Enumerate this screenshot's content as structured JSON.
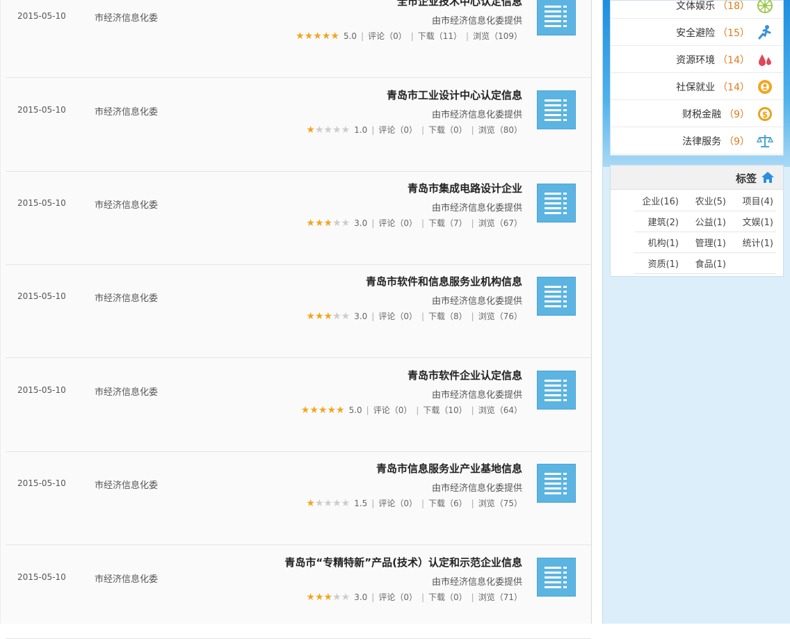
{
  "rows": [
    {
      "title": "全市企业技术中心认定信息",
      "provider": "由市经济信息化委提供",
      "rating": "5.0",
      "stars": 5,
      "comments_label": "评论（0）",
      "downloads_label": "下载（11）",
      "views_label": "浏览（109）",
      "source": "市经济信息化委",
      "date": "2015-05-10"
    },
    {
      "title": "青岛市工业设计中心认定信息",
      "provider": "由市经济信息化委提供",
      "rating": "1.0",
      "stars": 1,
      "comments_label": "评论（0）",
      "downloads_label": "下载（0）",
      "views_label": "浏览（80）",
      "source": "市经济信息化委",
      "date": "2015-05-10"
    },
    {
      "title": "青岛市集成电路设计企业",
      "provider": "由市经济信息化委提供",
      "rating": "3.0",
      "stars": 3,
      "comments_label": "评论（0）",
      "downloads_label": "下载（7）",
      "views_label": "浏览（67）",
      "source": "市经济信息化委",
      "date": "2015-05-10"
    },
    {
      "title": "青岛市软件和信息服务业机构信息",
      "provider": "由市经济信息化委提供",
      "rating": "3.0",
      "stars": 3,
      "comments_label": "评论（0）",
      "downloads_label": "下载（8）",
      "views_label": "浏览（76）",
      "source": "市经济信息化委",
      "date": "2015-05-10"
    },
    {
      "title": "青岛市软件企业认定信息",
      "provider": "由市经济信息化委提供",
      "rating": "5.0",
      "stars": 5,
      "comments_label": "评论（0）",
      "downloads_label": "下载（10）",
      "views_label": "浏览（64）",
      "source": "市经济信息化委",
      "date": "2015-05-10"
    },
    {
      "title": "青岛市信息服务业产业基地信息",
      "provider": "由市经济信息化委提供",
      "rating": "1.5",
      "stars": 1,
      "comments_label": "评论（0）",
      "downloads_label": "下载（6）",
      "views_label": "浏览（75）",
      "source": "市经济信息化委",
      "date": "2015-05-10"
    },
    {
      "title": "青岛市“专精特新”产品(技术）认定和示范企业信息",
      "provider": "由市经济信息化委提供",
      "rating": "3.0",
      "stars": 3,
      "comments_label": "评论（0）",
      "downloads_label": "下载（0）",
      "views_label": "浏览（71）",
      "source": "市经济信息化委",
      "date": "2015-05-10"
    }
  ],
  "categories": [
    {
      "label": "文体娱乐",
      "count": "（18）",
      "icon": "film-reel-icon",
      "color": "#9cc54a"
    },
    {
      "label": "安全避险",
      "count": "（15）",
      "icon": "running-person-icon",
      "color": "#3a8fd8"
    },
    {
      "label": "资源环境",
      "count": "（14）",
      "icon": "water-drops-icon",
      "color": "#e0475a"
    },
    {
      "label": "社保就业",
      "count": "（14）",
      "icon": "gear-person-icon",
      "color": "#f2a51d"
    },
    {
      "label": "财税金融",
      "count": "（9）",
      "icon": "coin-icon",
      "color": "#e8a21b"
    },
    {
      "label": "法律服务",
      "count": "（9）",
      "icon": "scales-icon",
      "color": "#4aa3d3"
    }
  ],
  "tags": {
    "header": "标签",
    "items": [
      [
        "企业(16)",
        "农业(5)",
        "项目(4)"
      ],
      [
        "建筑(2)",
        "公益(1)",
        "文娱(1)"
      ],
      [
        "机构(1)",
        "管理(1)",
        "统计(1)"
      ],
      [
        "资质(1)",
        "食品(1)"
      ]
    ]
  },
  "colors": {
    "star_on": "#f2a51d",
    "star_off": "#cccccc",
    "icon_bg": "#5bb4e1",
    "count": "#e07b1c"
  }
}
